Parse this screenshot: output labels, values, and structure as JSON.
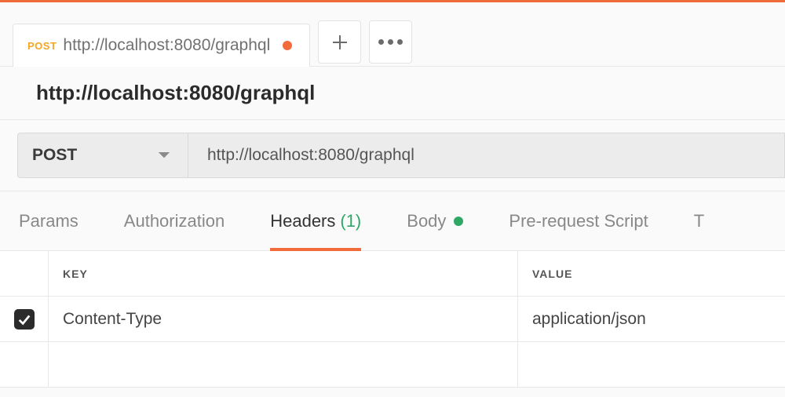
{
  "tab": {
    "method": "POST",
    "title": "http://localhost:8080/graphql",
    "unsaved": true
  },
  "request": {
    "title": "http://localhost:8080/graphql",
    "method": "POST",
    "url": "http://localhost:8080/graphql"
  },
  "subtabs": {
    "params": "Params",
    "authorization": "Authorization",
    "headers": "Headers",
    "headers_count": "(1)",
    "body": "Body",
    "prerequest": "Pre-request Script",
    "tests": "T"
  },
  "headers_table": {
    "col_key": "KEY",
    "col_value": "VALUE",
    "rows": [
      {
        "enabled": true,
        "key": "Content-Type",
        "value": "application/json"
      }
    ]
  }
}
